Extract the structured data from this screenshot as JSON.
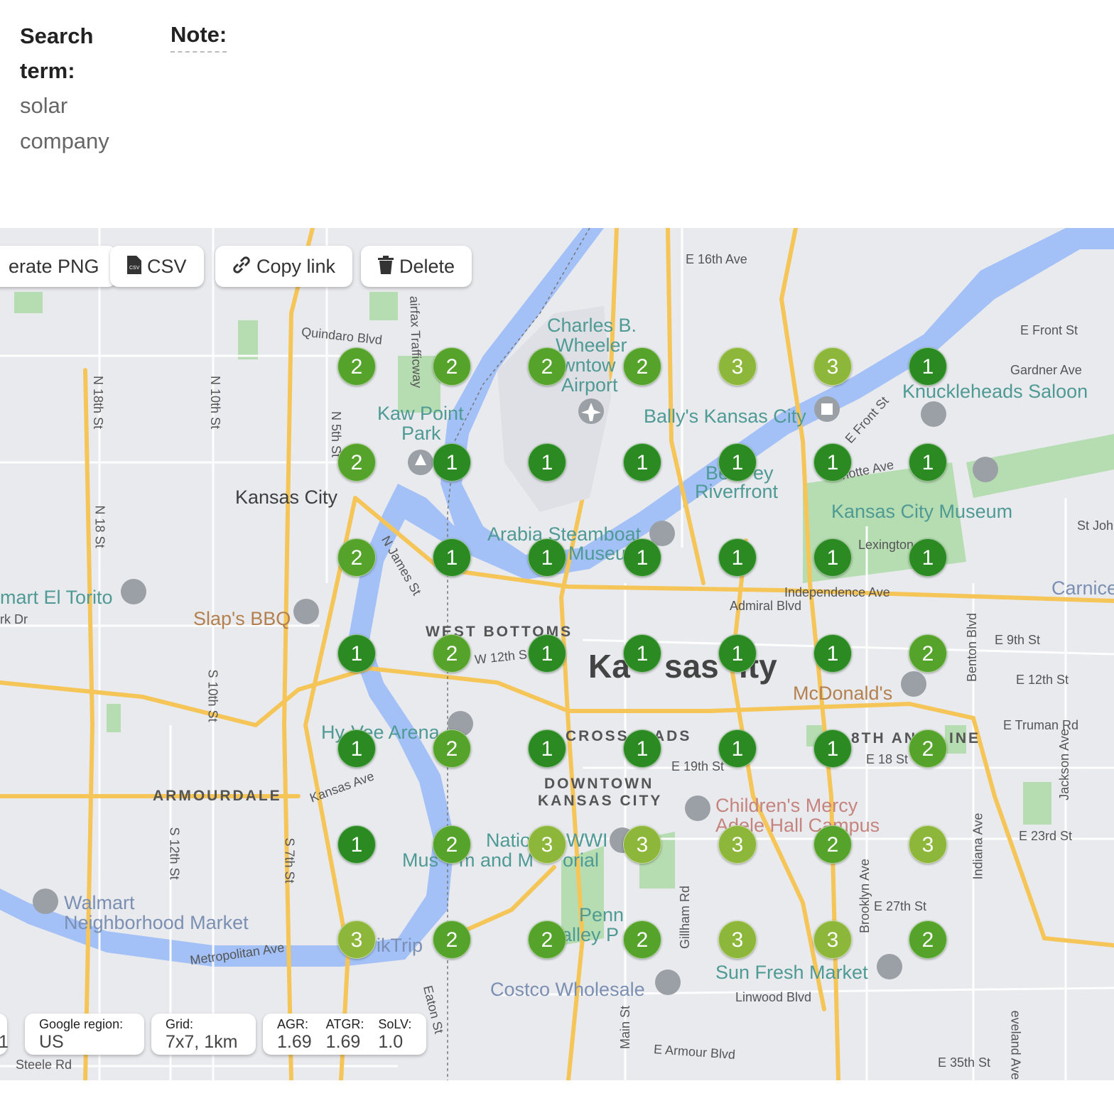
{
  "header": {
    "search_label": "Search term:",
    "search_value": "solar company",
    "note_label": "Note:"
  },
  "toolbar": {
    "png_label": "erate PNG",
    "csv_label": "CSV",
    "copy_label": "Copy link",
    "delete_label": "Delete"
  },
  "info": {
    "left_fragment": "1",
    "region_key": "Google region:",
    "region_value": "US",
    "grid_key": "Grid:",
    "grid_value": "7x7, 1km",
    "agr_key": "AGR:",
    "agr_value": "1.69",
    "atgr_key": "ATGR:",
    "atgr_value": "1.69",
    "solv_key": "SoLV:",
    "solv_value": "1.0"
  },
  "map_labels": {
    "charles": "Charles B.",
    "wheeler": "Wheeler",
    "downtown_frag": "wntow",
    "airport": "Airport",
    "kaw_point": "Kaw Point",
    "park": "Park",
    "ballys": "Bally's Kansas City",
    "knuckleheads": "Knuckleheads Saloon",
    "kansas_city_ks": "Kansas City",
    "berkley1": "Be",
    "berkley2": "ey",
    "riverfront": "Riverfront",
    "kc_museum": "Kansas City Museum",
    "arabia": "Arabia Steamboat",
    "museum_frag": "Museu",
    "el_torito": "mart El Torito",
    "slaps": "Slap's BBQ",
    "west_bottoms": "WEST BOTTOMS",
    "big_kc1": "Ka",
    "big_kc2": "sas",
    "big_kc3": "ity",
    "mcdonalds": "McDonald's",
    "hyvee": "Hy-Vee Arena",
    "crossroads1": "CROSS",
    "crossroads2": "ADS",
    "eighteenth1": "8TH AN",
    "eighteenth2": "INE",
    "armourdale": "ARMOURDALE",
    "downtown1": "DOWNTOWN",
    "downtown2": "KANSAS CITY",
    "childrens1": "Children's Mercy",
    "childrens2": "Adele Hall Campus",
    "natio": "Natio",
    "wwi": "WWI",
    "museum_memorial1": "Mus",
    "museum_memorial2": "m and M",
    "museum_memorial3": "orial",
    "walmart1": "Walmart",
    "walmart2": "Neighborhood Market",
    "penn1": "Penn",
    "penn2": "alley P",
    "quiktrip": "ikTrip",
    "sun_fresh": "Sun Fresh Market",
    "costco": "Costco Wholesale",
    "carnic": "Carnice"
  },
  "streets": {
    "e16th": "E 16th Ave",
    "quindaro": "Quindaro Blvd",
    "fairfax": "airfax Trafficway",
    "efront": "E Front St",
    "gardner": "Gardner Ave",
    "efront_diag": "E Front St",
    "n18th": "N 18th St",
    "n10th": "N 10th St",
    "n5th": "N 5th St",
    "guinotte": "uinotte Ave",
    "stjoh": "St Joh",
    "n18st": "N 18 St",
    "njames": "N James St",
    "lexington": "Lexington",
    "independence": "Independence Ave",
    "admiral": "Admiral Blvd",
    "parkdr": "rk Dr",
    "benton": "Benton Blvd",
    "e9th": "E 9th St",
    "w12th": "W 12th S",
    "e12th": "E 12th St",
    "s10th": "S 10th St",
    "truman": "E Truman Rd",
    "jackson": "Jackson Ave",
    "e18": "E 18 St",
    "e19th": "E 19th St",
    "kansasave": "Kansas Ave",
    "s12th": "S 12th St",
    "s7th": "S 7th St",
    "e23rd": "E 23rd St",
    "indiana": "Indiana Ave",
    "brooklyn": "Brooklyn Ave",
    "gillham": "Gillham Rd",
    "e27th": "E 27th St",
    "metropolitan": "Metropolitan Ave",
    "linwood": "Linwood Blvd",
    "eaton": "Eaton St",
    "mainst": "Main St",
    "armourblvd": "E Armour Blvd",
    "e35th": "E 35th St",
    "cleveland": "eveland Ave",
    "steele": "Steele Rd"
  },
  "ranks": [
    [
      2,
      2,
      2,
      2,
      3,
      3,
      1
    ],
    [
      2,
      1,
      1,
      1,
      1,
      1,
      1
    ],
    [
      2,
      1,
      1,
      1,
      1,
      1,
      1
    ],
    [
      1,
      2,
      1,
      1,
      1,
      1,
      2
    ],
    [
      1,
      2,
      1,
      1,
      1,
      1,
      2
    ],
    [
      1,
      2,
      3,
      3,
      3,
      2,
      3
    ],
    [
      3,
      2,
      2,
      2,
      3,
      3,
      2
    ]
  ],
  "colors": {
    "rank1": "#2b8a22",
    "rank2": "#56a32c",
    "rank3": "#8db73a",
    "water": "#a3c1f7",
    "park": "#b6ddb1",
    "highway": "#f5c558",
    "land": "#e9eaee"
  }
}
